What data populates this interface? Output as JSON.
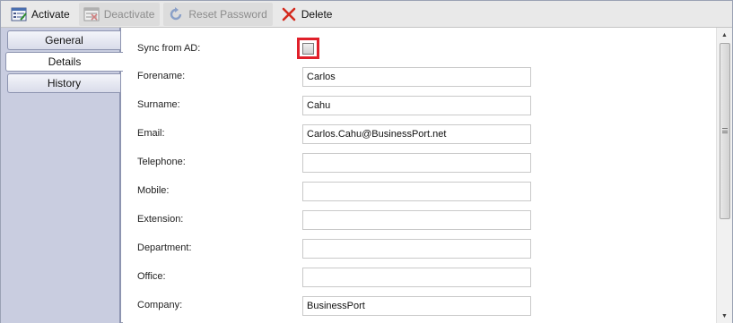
{
  "toolbar": {
    "activate_label": "Activate",
    "deactivate_label": "Deactivate",
    "reset_password_label": "Reset Password",
    "delete_label": "Delete"
  },
  "tabs": [
    {
      "label": "General"
    },
    {
      "label": "Details"
    },
    {
      "label": "History"
    }
  ],
  "active_tab": "Details",
  "form": {
    "sync_label": "Sync from AD:",
    "sync_checked": false,
    "fields": [
      {
        "label": "Forename:",
        "value": "Carlos"
      },
      {
        "label": "Surname:",
        "value": "Cahu"
      },
      {
        "label": "Email:",
        "value": "Carlos.Cahu@BusinessPort.net"
      },
      {
        "label": "Telephone:",
        "value": ""
      },
      {
        "label": "Mobile:",
        "value": ""
      },
      {
        "label": "Extension:",
        "value": ""
      },
      {
        "label": "Department:",
        "value": ""
      },
      {
        "label": "Office:",
        "value": ""
      },
      {
        "label": "Company:",
        "value": "BusinessPort"
      }
    ]
  },
  "colors": {
    "highlight": "#e0202a",
    "tab_panel": "#c9cde0",
    "toolbar": "#e9e9e9"
  }
}
